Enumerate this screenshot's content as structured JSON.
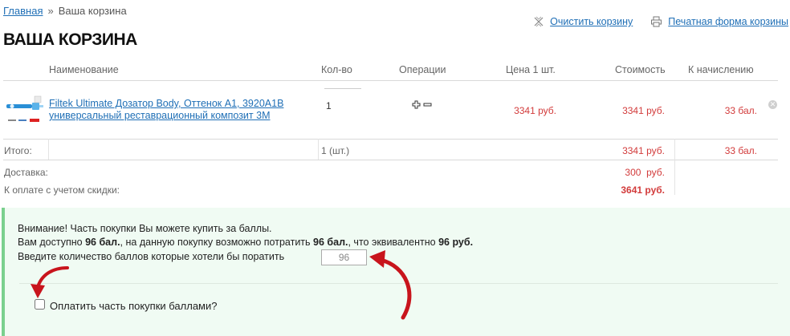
{
  "breadcrumb": {
    "home": "Главная",
    "separator": "»",
    "current": "Ваша корзина"
  },
  "actions": {
    "clear_cart": "Очистить корзину",
    "print_form": "Печатная форма корзины"
  },
  "page_title": "ВАША КОРЗИНА",
  "table": {
    "headers": {
      "name": "Наименование",
      "qty": "Кол-во",
      "ops": "Операции",
      "price": "Цена 1 шт.",
      "cost": "Стоимость",
      "points": "К начислению"
    },
    "item": {
      "name": "Filtek Ultimate Дозатор Body, Оттенок А1, 3920А1В универсальный реставрационный композит 3М",
      "qty": "1",
      "price": "3341 руб.",
      "cost": "3341 руб.",
      "points": "33 бал."
    },
    "total": {
      "label": "Итого:",
      "qty": "1 (шт.)",
      "cost": "3341 руб.",
      "points": "33 бал."
    },
    "delivery": {
      "label": "Доставка:",
      "value": "300  руб."
    },
    "to_pay": {
      "label": "К оплате с учетом скидки:",
      "value": "3641 руб."
    }
  },
  "points": {
    "line1": "Внимание! Часть покупки Вы можете купить за баллы.",
    "line2_prefix": "Вам доступно ",
    "available": "96 бал.",
    "line2_mid": ", на данную покупку возможно потратить ",
    "spendable": "96 бал.",
    "line2_mid2": ", что эквивалентно ",
    "equivalent": "96 руб.",
    "line3": "Введите количество баллов которые хотели бы поратить",
    "input_value": "96",
    "checkbox_label": "Оплатить часть покупки баллами?"
  },
  "colors": {
    "link": "#1f6fb6",
    "price_red": "#d23b3b",
    "box_bg": "#f0fbf3",
    "box_border": "#7bd08e",
    "arrow": "#c8141c"
  }
}
